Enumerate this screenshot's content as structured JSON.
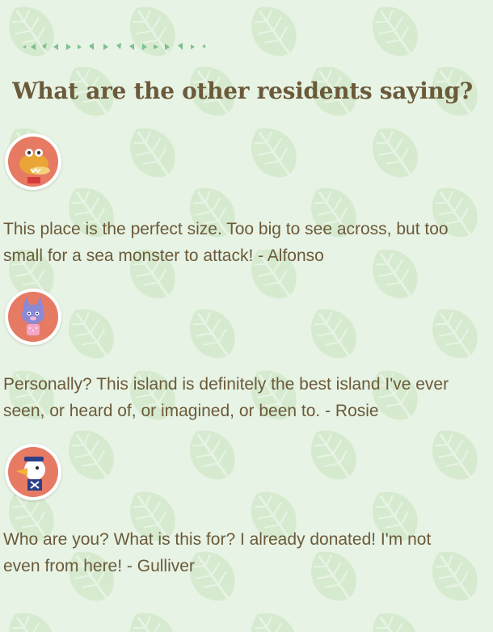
{
  "colors": {
    "background": "#e7f3e4",
    "leaf_pattern": "#d3e8cf",
    "heading_text": "#6b5a3a",
    "body_text": "#6b5a3a",
    "avatar_circle": "#e67a63",
    "deco_line": "#7fbf8f"
  },
  "heading": "What are the other residents saying?",
  "testimonials": [
    {
      "avatar_icon": "alfonso-avatar-icon",
      "quote": "This place is the perfect size. Too big to see across, but too small for a sea monster to attack! - Alfonso"
    },
    {
      "avatar_icon": "rosie-avatar-icon",
      "quote": "Personally? This island is definitely the best island I've ever seen, or heard of, or imagined, or been to. - Rosie"
    },
    {
      "avatar_icon": "gulliver-avatar-icon",
      "quote": "Who are you? What is this for? I already donated! I'm not even from here! - Gulliver"
    }
  ]
}
